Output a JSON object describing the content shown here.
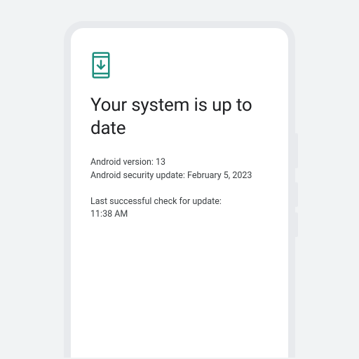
{
  "update": {
    "title": "Your system is up to date",
    "version_line": "Android version: 13",
    "security_line": "Android security update: February 5, 2023",
    "last_check_label": "Last successful check for update:",
    "last_check_time": "11:38 AM"
  },
  "colors": {
    "accent": "#1e8e7e"
  }
}
